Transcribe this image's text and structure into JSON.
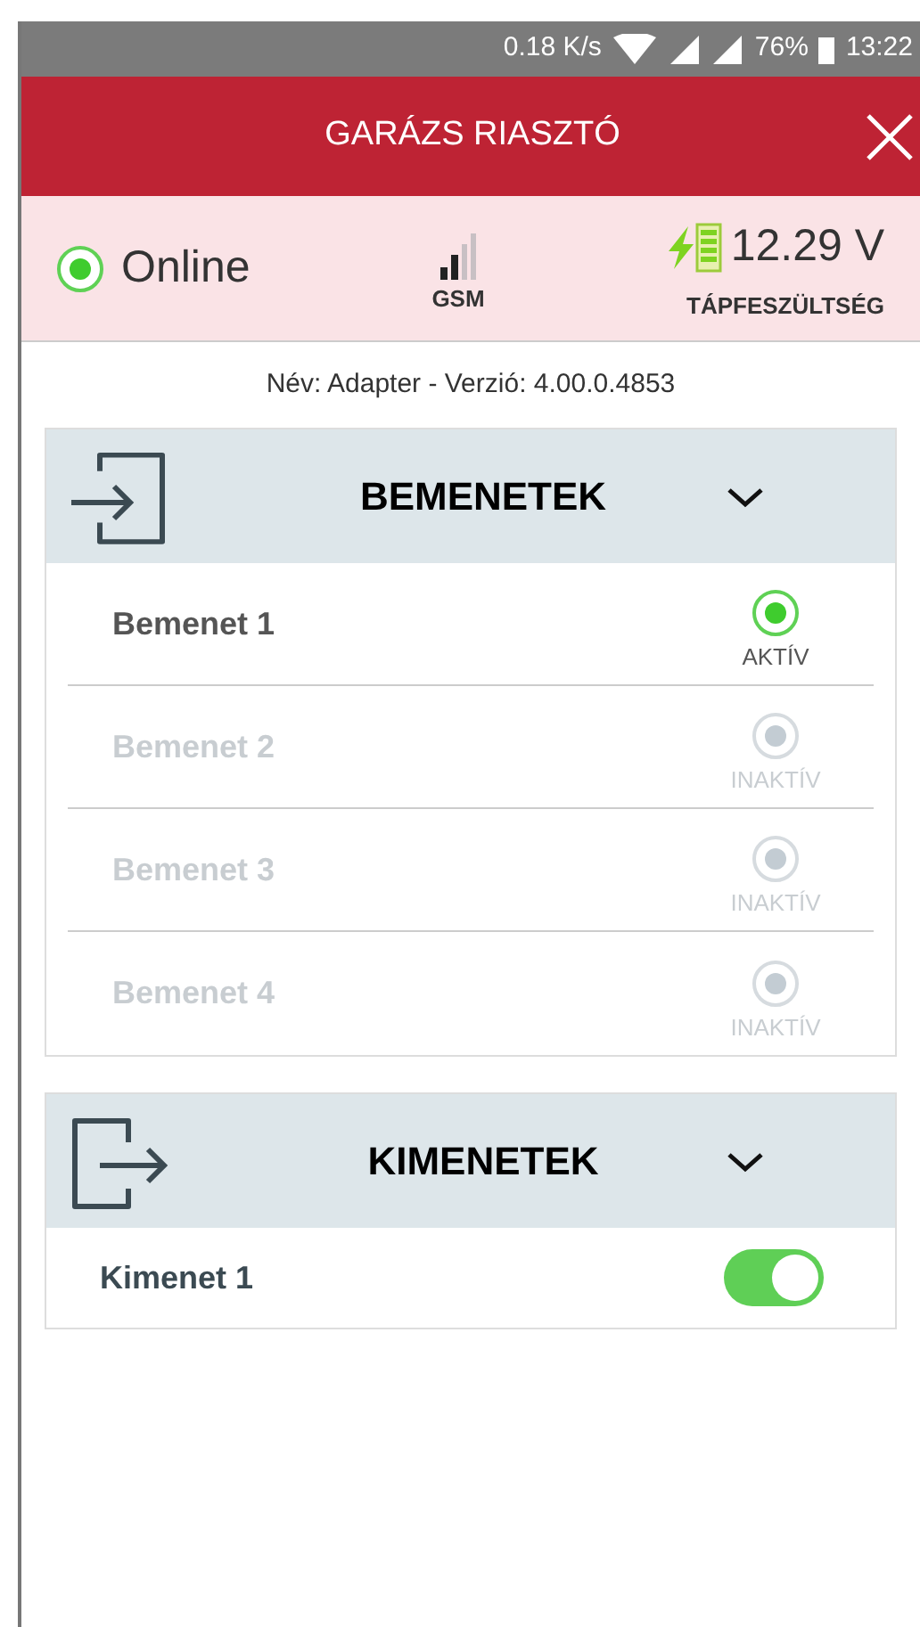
{
  "status_bar": {
    "speed": "0.18 K/s",
    "battery": "76%",
    "time": "13:22"
  },
  "header": {
    "title": "GARÁZS RIASZTÓ"
  },
  "device_status": {
    "online": true,
    "online_label": "Online",
    "gsm_label": "GSM",
    "voltage": "12.29 V",
    "voltage_label": "TÁPFESZÜLTSÉG"
  },
  "device_info": "Név: Adapter - Verzió: 4.00.0.4853",
  "inputs": {
    "title": "BEMENETEK",
    "expanded": true,
    "items": [
      {
        "name": "Bemenet 1",
        "active": true,
        "state_label": "AKTÍV"
      },
      {
        "name": "Bemenet 2",
        "active": false,
        "state_label": "INAKTÍV"
      },
      {
        "name": "Bemenet 3",
        "active": false,
        "state_label": "INAKTÍV"
      },
      {
        "name": "Bemenet 4",
        "active": false,
        "state_label": "INAKTÍV"
      }
    ]
  },
  "outputs": {
    "title": "KIMENETEK",
    "expanded": true,
    "items": [
      {
        "name": "Kimenet 1",
        "on": true
      }
    ]
  }
}
